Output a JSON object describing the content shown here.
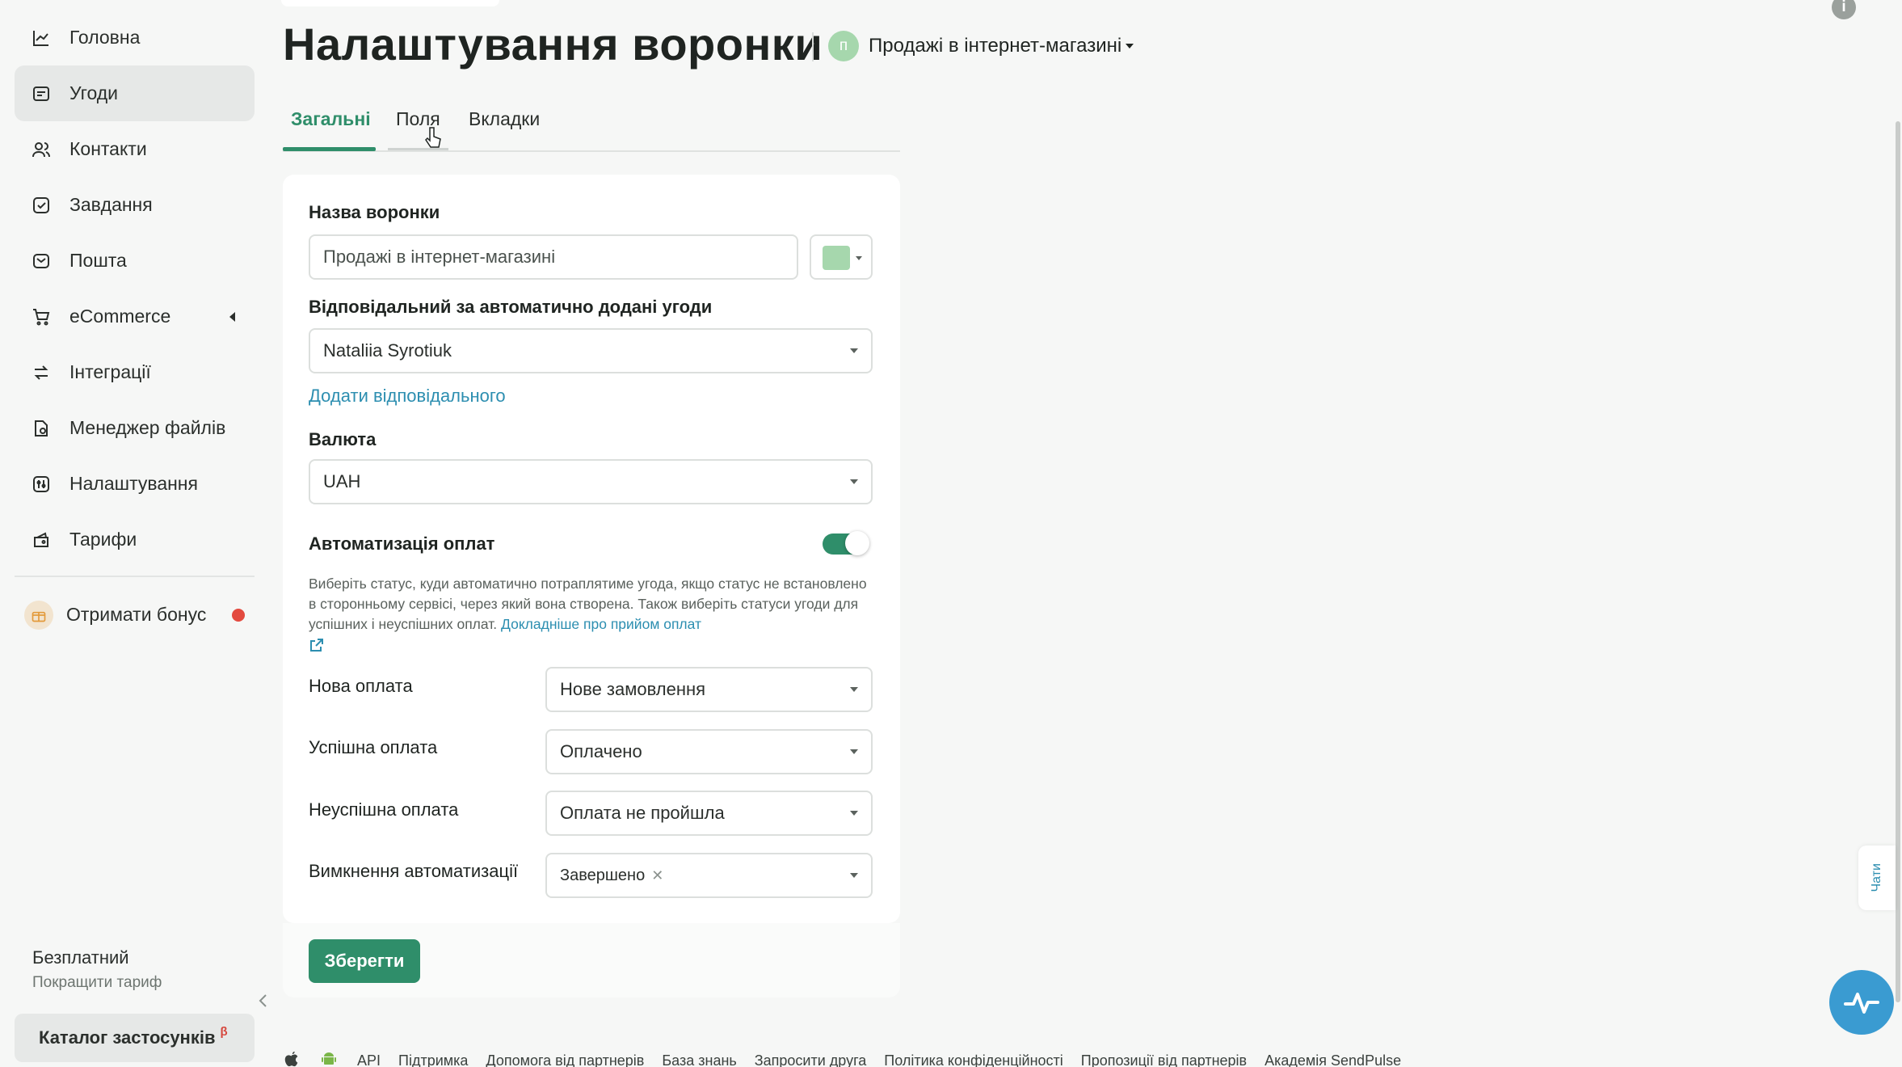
{
  "sidebar": {
    "items": [
      {
        "label": "Головна",
        "icon": "chart-line-icon"
      },
      {
        "label": "Угоди",
        "icon": "deals-icon"
      },
      {
        "label": "Контакти",
        "icon": "contacts-icon"
      },
      {
        "label": "Завдання",
        "icon": "tasks-icon"
      },
      {
        "label": "Пошта",
        "icon": "mail-icon"
      },
      {
        "label": "eCommerce",
        "icon": "cart-icon"
      },
      {
        "label": "Інтеграції",
        "icon": "integrations-icon"
      },
      {
        "label": "Менеджер файлів",
        "icon": "files-icon"
      },
      {
        "label": "Налаштування",
        "icon": "settings-icon"
      },
      {
        "label": "Тарифи",
        "icon": "tariffs-icon"
      }
    ],
    "bonus": "Отримати бонус",
    "plan_name": "Безплатний",
    "plan_upgrade": "Покращити тариф",
    "catalog": "Каталог застосунків",
    "catalog_badge": "β"
  },
  "header": {
    "title": "Налаштування воронки",
    "funnel_badge": "п",
    "funnel_name": "Продажі в інтернет-магазині"
  },
  "tabs": [
    "Загальні",
    "Поля",
    "Вкладки"
  ],
  "form": {
    "name_label": "Назва воронки",
    "name_value": "Продажі в інтернет-магазині",
    "responsible_label": "Відповідальний за автоматично додані угоди",
    "responsible_value": "Nataliia Syrotiuk",
    "add_responsible": "Додати відповідального",
    "currency_label": "Валюта",
    "currency_value": "UAH",
    "automation_label": "Автоматизація оплат",
    "automation_desc": "Виберіть статус, куди автоматично потраплятиме угода, якщо статус не встановлено в сторонньому сервісі, через який вона створена. Також виберіть статуси угоди для успішних і неуспішних оплат. ",
    "automation_link": "Докладніше про прийом оплат",
    "rows": [
      {
        "label": "Нова оплата",
        "value": "Нове замовлення"
      },
      {
        "label": "Успішна оплата",
        "value": "Оплачено"
      },
      {
        "label": "Неуспішна оплата",
        "value": "Оплата не пройшла"
      }
    ],
    "disable_label": "Вимкнення автоматизації",
    "disable_chip": "Завершено",
    "save": "Зберегти"
  },
  "footer": {
    "links": [
      "API",
      "Підтримка",
      "Допомога від партнерів",
      "База знань",
      "Запросити друга",
      "Політика конфіденційності",
      "Пропозиції від партнерів",
      "Академія SendPulse"
    ]
  },
  "chat_tab": "Чати",
  "colors": {
    "accent": "#2f8e6a",
    "link": "#2c8eb0",
    "funnel": "#a6d7ad"
  }
}
